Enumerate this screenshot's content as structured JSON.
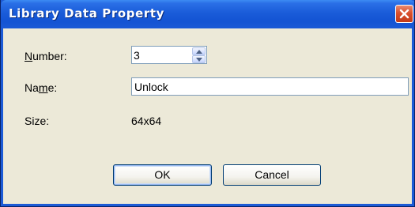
{
  "window": {
    "title": "Library Data Property",
    "close_icon": "close-icon"
  },
  "colors": {
    "titlebar": "#1353d3",
    "client_bg": "#ece9d8",
    "close_button": "#d9502e",
    "field_border": "#7f9db9"
  },
  "form": {
    "number": {
      "label_pre": "",
      "label_mnemonic": "N",
      "label_post": "umber:",
      "value": "3"
    },
    "name": {
      "label_pre": "Na",
      "label_mnemonic": "m",
      "label_post": "e:",
      "value": "Unlock"
    },
    "size": {
      "label": "Size:",
      "value": "64x64"
    }
  },
  "buttons": {
    "ok_label": "OK",
    "cancel_label": "Cancel"
  }
}
